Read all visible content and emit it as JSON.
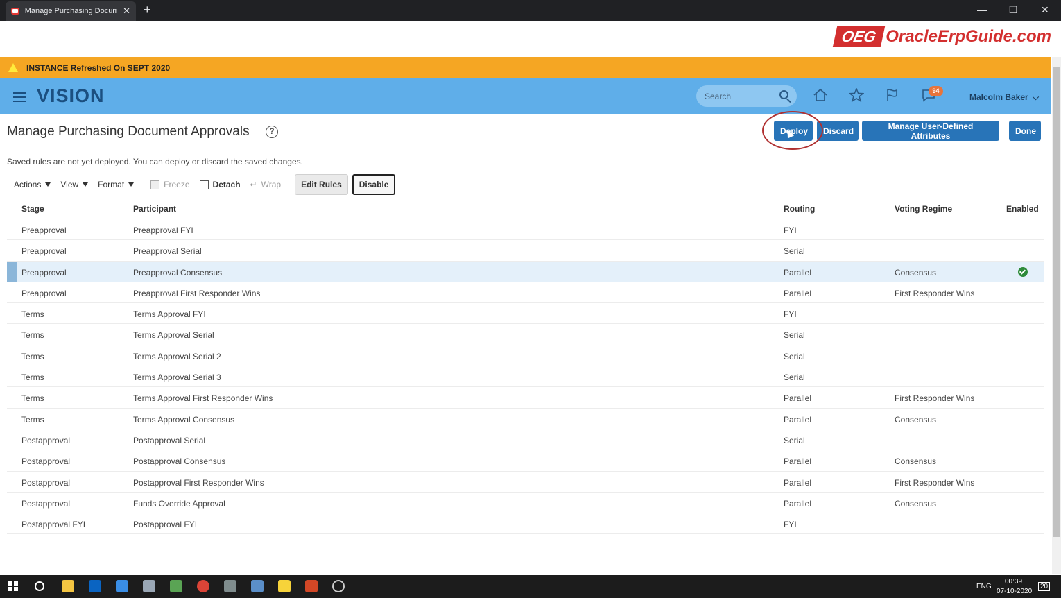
{
  "browser": {
    "tab_title": "Manage Purchasing Document A",
    "close_glyph": "✕",
    "new_tab_glyph": "+",
    "minimize_glyph": "—",
    "restore_glyph": "❐",
    "window_close_glyph": "✕"
  },
  "brand": {
    "box": "OEG",
    "text": "OracleErpGuide.com"
  },
  "banner": {
    "text": "INSTANCE Refreshed On SEPT 2020"
  },
  "header": {
    "logo": "VISION",
    "search_placeholder": "Search",
    "notification_count": "94",
    "user_name": "Malcolm Baker",
    "icons": [
      "home-icon",
      "star-icon",
      "flag-icon",
      "notifications-icon"
    ]
  },
  "page": {
    "title": "Manage Purchasing Document Approvals",
    "info": "Saved rules are not yet deployed. You can deploy or discard the saved changes.",
    "buttons": {
      "deploy": "Deploy",
      "discard": "Discard",
      "manage_attributes": "Manage User-Defined Attributes",
      "done": "Done"
    }
  },
  "toolbar": {
    "actions": "Actions",
    "view": "View",
    "format": "Format",
    "freeze": "Freeze",
    "detach": "Detach",
    "wrap": "Wrap",
    "edit_rules": "Edit Rules",
    "disable": "Disable"
  },
  "table": {
    "columns": [
      "Stage",
      "Participant",
      "Routing",
      "Voting Regime",
      "Enabled"
    ],
    "rows": [
      {
        "stage": "Preapproval",
        "participant": "Preapproval FYI",
        "routing": "FYI",
        "voting": "",
        "enabled": false
      },
      {
        "stage": "Preapproval",
        "participant": "Preapproval Serial",
        "routing": "Serial",
        "voting": "",
        "enabled": false
      },
      {
        "stage": "Preapproval",
        "participant": "Preapproval Consensus",
        "routing": "Parallel",
        "voting": "Consensus",
        "enabled": true,
        "selected": true
      },
      {
        "stage": "Preapproval",
        "participant": "Preapproval First Responder Wins",
        "routing": "Parallel",
        "voting": "First Responder Wins",
        "enabled": false
      },
      {
        "stage": "Terms",
        "participant": "Terms Approval FYI",
        "routing": "FYI",
        "voting": "",
        "enabled": false
      },
      {
        "stage": "Terms",
        "participant": "Terms Approval Serial",
        "routing": "Serial",
        "voting": "",
        "enabled": false
      },
      {
        "stage": "Terms",
        "participant": "Terms Approval Serial 2",
        "routing": "Serial",
        "voting": "",
        "enabled": false
      },
      {
        "stage": "Terms",
        "participant": "Terms Approval Serial 3",
        "routing": "Serial",
        "voting": "",
        "enabled": false
      },
      {
        "stage": "Terms",
        "participant": "Terms Approval First Responder Wins",
        "routing": "Parallel",
        "voting": "First Responder Wins",
        "enabled": false
      },
      {
        "stage": "Terms",
        "participant": "Terms Approval Consensus",
        "routing": "Parallel",
        "voting": "Consensus",
        "enabled": false
      },
      {
        "stage": "Postapproval",
        "participant": "Postapproval Serial",
        "routing": "Serial",
        "voting": "",
        "enabled": false
      },
      {
        "stage": "Postapproval",
        "participant": "Postapproval Consensus",
        "routing": "Parallel",
        "voting": "Consensus",
        "enabled": false
      },
      {
        "stage": "Postapproval",
        "participant": "Postapproval First Responder Wins",
        "routing": "Parallel",
        "voting": "First Responder Wins",
        "enabled": false
      },
      {
        "stage": "Postapproval",
        "participant": "Funds Override Approval",
        "routing": "Parallel",
        "voting": "Consensus",
        "enabled": false
      },
      {
        "stage": "Postapproval FYI",
        "participant": "Postapproval FYI",
        "routing": "FYI",
        "voting": "",
        "enabled": false
      }
    ]
  },
  "taskbar": {
    "language": "ENG",
    "time": "00:39",
    "date": "07-10-2020",
    "notification_count": "20"
  },
  "colors": {
    "banner": "#f5a623",
    "header": "#5faee9",
    "primary_button": "#2874b8",
    "enabled_check": "#2e8b3a",
    "brand_red": "#d32f2f"
  }
}
